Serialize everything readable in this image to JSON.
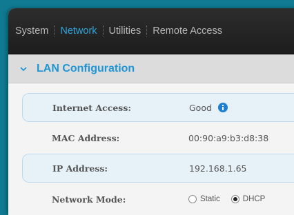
{
  "nav": {
    "tabs": [
      {
        "label": "System"
      },
      {
        "label": "Network"
      },
      {
        "label": "Utilities"
      },
      {
        "label": "Remote Access"
      }
    ],
    "active_color": "#2fa6df"
  },
  "section": {
    "title": "LAN Configuration",
    "icon": "chevron-down-icon"
  },
  "fields": {
    "internet_access": {
      "label": "Internet Access:",
      "value": "Good",
      "icon": "info-icon"
    },
    "mac_address": {
      "label": "MAC Address:",
      "value": "00:90:a9:b3:d8:38"
    },
    "ip_address": {
      "label": "IP Address:",
      "value": "192.168.1.65"
    },
    "network_mode": {
      "label": "Network Mode:",
      "options": [
        {
          "label": "Static",
          "selected": false
        },
        {
          "label": "DHCP",
          "selected": true
        }
      ]
    }
  }
}
